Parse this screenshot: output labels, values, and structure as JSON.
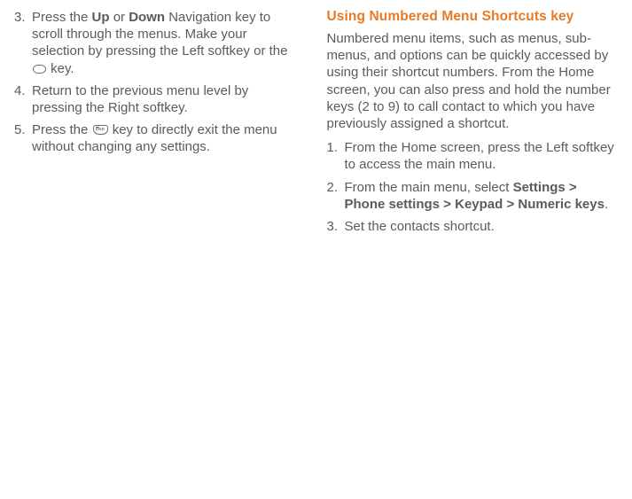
{
  "left": {
    "start": 2,
    "items": [
      {
        "segments": [
          {
            "t": "Press the "
          },
          {
            "t": "Up",
            "bold": true
          },
          {
            "t": " or "
          },
          {
            "t": "Down",
            "bold": true
          },
          {
            "t": " Navigation key to scroll through the menus. Make your selection by pressing the Left softkey or the "
          },
          {
            "icon": "round-key"
          },
          {
            "t": " key."
          }
        ]
      },
      {
        "segments": [
          {
            "t": "Return to the previous menu level by pressing the Right softkey."
          }
        ]
      },
      {
        "segments": [
          {
            "t": "Press the "
          },
          {
            "icon": "end-key"
          },
          {
            "t": " key to directly exit the menu without changing any settings."
          }
        ]
      }
    ]
  },
  "right": {
    "heading": "Using Numbered Menu Shortcuts key",
    "intro": "Numbered menu items, such as menus, sub-menus, and options can be quickly accessed by using their shortcut numbers. From the Home screen, you can also press and hold the number keys (2 to 9) to call contact to which you have previously assigned a shortcut.",
    "start": 0,
    "items": [
      {
        "segments": [
          {
            "t": "From the Home screen, press the Left softkey to access the main menu."
          }
        ]
      },
      {
        "segments": [
          {
            "t": "From the main menu, select "
          },
          {
            "t": "Settings > Phone settings > Keypad > Numeric keys",
            "bold": true
          },
          {
            "t": "."
          }
        ]
      },
      {
        "segments": [
          {
            "t": "Set the contacts shortcut."
          }
        ]
      }
    ]
  }
}
